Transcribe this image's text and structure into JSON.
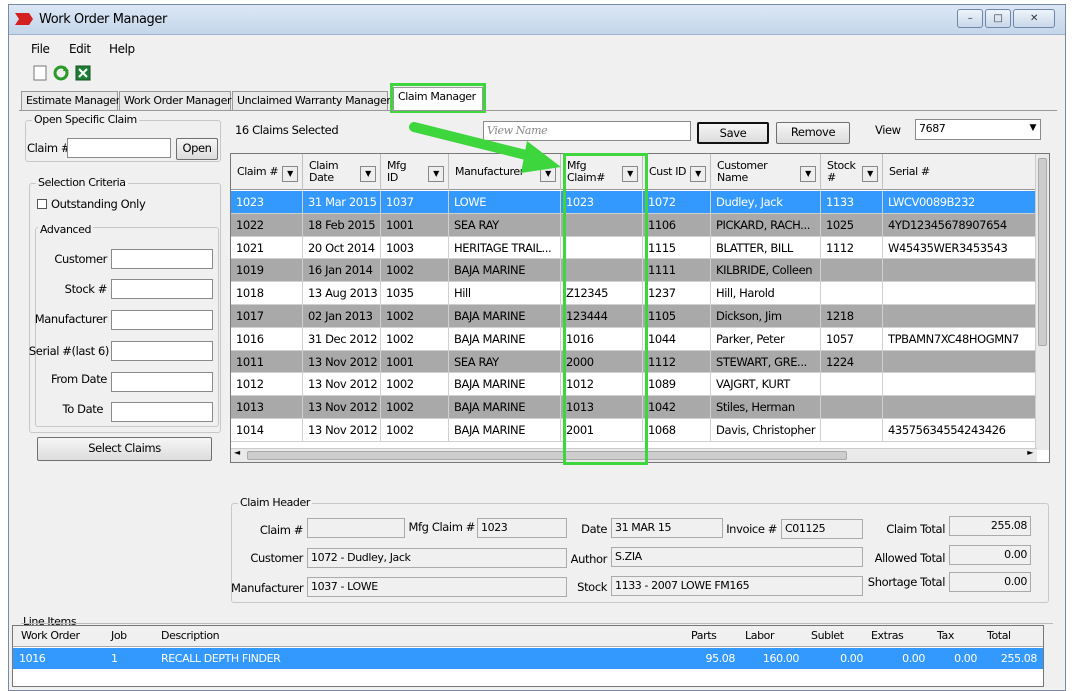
{
  "window": {
    "title": "Work Order Manager",
    "min_icon": "minimize-icon",
    "max_icon": "maximize-icon",
    "close_icon": "close-icon"
  },
  "menu": [
    "File",
    "Edit",
    "Help"
  ],
  "toolbar_icons": [
    "new-document-icon",
    "refresh-icon",
    "export-excel-icon"
  ],
  "tabs": [
    "Estimate Manager",
    "Work Order Manager",
    "Unclaimed Warranty Manager",
    "Claim Manager"
  ],
  "open_claim": {
    "caption": "Open Specific Claim",
    "claim_label": "Claim #",
    "claim_value": "",
    "open_button": "Open"
  },
  "selection": {
    "caption": "Selection Criteria",
    "outstanding_label": "Outstanding Only",
    "advanced_caption": "Advanced",
    "fields": [
      {
        "label": "Customer",
        "value": ""
      },
      {
        "label": "Stock #",
        "value": ""
      },
      {
        "label": "Manufacturer",
        "value": ""
      },
      {
        "label": "Serial #(last 6)",
        "value": ""
      },
      {
        "label": "From Date",
        "value": ""
      },
      {
        "label": "To Date",
        "value": ""
      }
    ],
    "select_button": "Select Claims"
  },
  "claims_count": "16 Claims Selected",
  "view_name_placeholder": "View Name",
  "save_button": "Save",
  "remove_button": "Remove",
  "view_label": "View",
  "view_value": "7687",
  "grid": {
    "columns": [
      "Claim #",
      "Claim\nDate",
      "Mfg\nID",
      "Manufacturer",
      "Mfg\nClaim#",
      "Cust ID",
      "Customer\nName",
      "Stock\n#",
      "Serial #"
    ],
    "rows": [
      {
        "style": "sel",
        "cells": [
          "1023",
          "31 Mar 2015",
          "1037",
          "LOWE",
          "1023",
          "1072",
          "Dudley, Jack",
          "1133",
          "LWCV0089B232"
        ]
      },
      {
        "style": "gray",
        "cells": [
          "1022",
          "18 Feb 2015",
          "1001",
          "SEA RAY",
          "",
          "1106",
          "PICKARD, RACH...",
          "1025",
          "4YD12345678907654"
        ]
      },
      {
        "style": "white",
        "cells": [
          "1021",
          "20 Oct 2014",
          "1003",
          "HERITAGE TRAIL...",
          "",
          "1115",
          "BLATTER, BILL",
          "1112",
          "W45435WER3453543"
        ]
      },
      {
        "style": "gray",
        "cells": [
          "1019",
          "16 Jan 2014",
          "1002",
          "BAJA MARINE",
          "",
          "1111",
          "KILBRIDE, Colleen",
          "",
          ""
        ]
      },
      {
        "style": "white",
        "cells": [
          "1018",
          "13 Aug 2013",
          "1035",
          "Hill",
          "Z12345",
          "1237",
          "Hill, Harold",
          "",
          ""
        ]
      },
      {
        "style": "gray",
        "cells": [
          "1017",
          "02 Jan 2013",
          "1002",
          "BAJA MARINE",
          "123444",
          "1105",
          "Dickson, Jim",
          "1218",
          ""
        ]
      },
      {
        "style": "white",
        "cells": [
          "1016",
          "31 Dec 2012",
          "1002",
          "BAJA MARINE",
          "1016",
          "1044",
          "Parker, Peter",
          "1057",
          "TPBAMN7XC48HOGMN7"
        ]
      },
      {
        "style": "gray",
        "cells": [
          "1011",
          "13 Nov 2012",
          "1001",
          "SEA RAY",
          "2000",
          "1112",
          "STEWART, GRE...",
          "1224",
          ""
        ]
      },
      {
        "style": "white",
        "cells": [
          "1012",
          "13 Nov 2012",
          "1002",
          "BAJA MARINE",
          "1012",
          "1089",
          "VAJGRT, KURT",
          "",
          ""
        ]
      },
      {
        "style": "gray",
        "cells": [
          "1013",
          "13 Nov 2012",
          "1002",
          "BAJA MARINE",
          "1013",
          "1042",
          "Stiles, Herman",
          "",
          ""
        ]
      },
      {
        "style": "white",
        "cells": [
          "1014",
          "13 Nov 2012",
          "1002",
          "BAJA MARINE",
          "2001",
          "1068",
          "Davis, Christopher",
          "",
          "43575634554243426"
        ]
      }
    ]
  },
  "claim_header": {
    "caption": "Claim Header",
    "claim_no_label": "Claim #",
    "claim_no": "",
    "mfg_claim_label": "Mfg Claim #",
    "mfg_claim": "1023",
    "date_label": "Date",
    "date": "31 MAR 15",
    "invoice_label": "Invoice #",
    "invoice": "C01125",
    "customer_label": "Customer",
    "customer": "1072 - Dudley, Jack",
    "author_label": "Author",
    "author": "S.ZIA",
    "manufacturer_label": "Manufacturer",
    "manufacturer": "1037 - LOWE",
    "stock_label": "Stock",
    "stock": "1133 - 2007 LOWE FM165",
    "claim_total_label": "Claim Total",
    "claim_total": "255.08",
    "allowed_total_label": "Allowed Total",
    "allowed_total": "0.00",
    "shortage_total_label": "Shortage Total",
    "shortage_total": "0.00"
  },
  "line_items": {
    "caption": "Line Items",
    "columns": [
      "Work Order",
      "Job",
      "Description",
      "Parts",
      "Labor",
      "Sublet",
      "Extras",
      "Tax",
      "Total"
    ],
    "row": [
      "1016",
      "1",
      "RECALL DEPTH FINDER",
      "95.08",
      "160.00",
      "0.00",
      "0.00",
      "0.00",
      "255.08"
    ]
  },
  "colors": {
    "selection": "#3399ff",
    "gray_row": "#a9a9a9",
    "highlight": "#3dd63d"
  }
}
